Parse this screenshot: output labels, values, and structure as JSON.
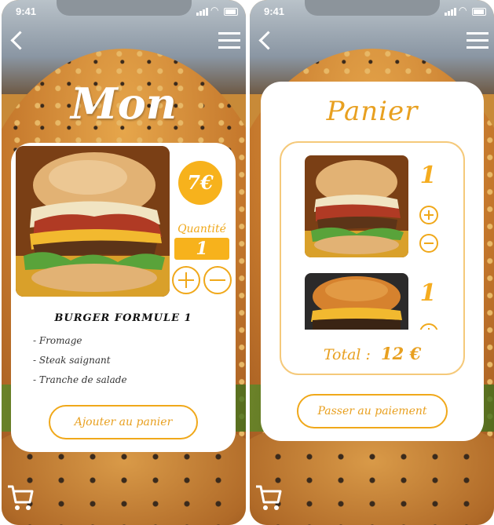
{
  "status": {
    "time": "9:41"
  },
  "product_screen": {
    "title": "Mon",
    "price": "7€",
    "quantity_label": "Quantité",
    "quantity_value": "1",
    "product_name": "BURGER FORMULE 1",
    "ingredients": [
      "- Fromage",
      "- Steak saignant",
      "- Tranche de salade"
    ],
    "add_button": "Ajouter au panier"
  },
  "cart_screen": {
    "title": "Panier",
    "items": [
      {
        "quantity": "1"
      },
      {
        "quantity": "1"
      }
    ],
    "total_label": "Total :",
    "total_value": "12 €",
    "pay_button": "Passer au paiement"
  },
  "colors": {
    "accent": "#f7b21c",
    "accent_text": "#e8a020",
    "card": "#ffffff"
  },
  "icons": [
    "back-arrow-icon",
    "hamburger-menu-icon",
    "shopping-cart-icon",
    "plus-icon",
    "minus-icon"
  ]
}
